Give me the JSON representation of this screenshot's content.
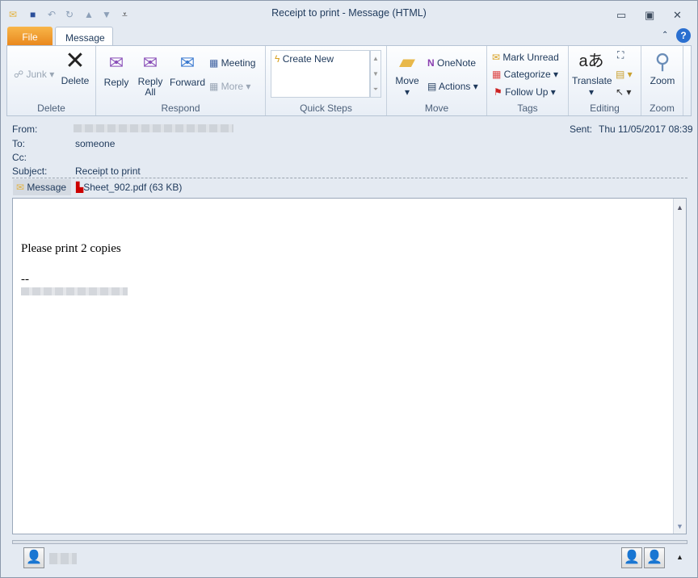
{
  "window": {
    "title": "Receipt to print  -  Message (HTML)"
  },
  "tabs": [
    {
      "label": "File"
    },
    {
      "label": "Message"
    }
  ],
  "ribbon": {
    "delete": {
      "label": "Delete",
      "junk": "Junk",
      "delete": "Delete"
    },
    "respond": {
      "label": "Respond",
      "reply": "Reply",
      "reply_all_1": "Reply",
      "reply_all_2": "All",
      "forward": "Forward",
      "meeting": "Meeting",
      "more": "More"
    },
    "quick_steps": {
      "label": "Quick Steps",
      "create_new": "Create New"
    },
    "move": {
      "label": "Move",
      "move": "Move",
      "onenote": "OneNote",
      "actions": "Actions"
    },
    "tags": {
      "label": "Tags",
      "mark_unread": "Mark Unread",
      "categorize": "Categorize",
      "follow_up": "Follow Up"
    },
    "editing": {
      "label": "Editing",
      "translate": "Translate"
    },
    "zoom": {
      "label": "Zoom",
      "zoom": "Zoom"
    }
  },
  "header": {
    "from_label": "From:",
    "to_label": "To:",
    "to": "someone",
    "cc_label": "Cc:",
    "subject_label": "Subject:",
    "subject": "Receipt to print",
    "sent_label": "Sent:",
    "sent": "Thu 11/05/2017 08:39"
  },
  "attachments": {
    "message": "Message",
    "file": "Sheet_902.pdf (63 KB)"
  },
  "message": {
    "line1": "Please print 2 copies",
    "sig": "--"
  }
}
